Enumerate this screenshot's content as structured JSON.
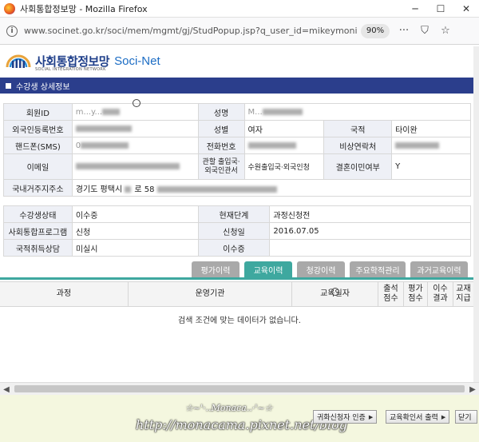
{
  "window": {
    "title": "사회통합정보망 - Mozilla Firefox",
    "minimize": "─",
    "maximize": "☐",
    "close": "✕"
  },
  "toolbar": {
    "url": "www.socinet.go.kr/soci/mem/mgmt/gj/StudPopup.jsp?q_user_id=mikeymonica",
    "zoom": "90%",
    "info_glyph": "i",
    "more_glyph": "···",
    "pocket_glyph": "⛉",
    "bookmark_glyph": "☆"
  },
  "logo": {
    "korean": "사회통합정보망",
    "english": "Soci-Net",
    "subtitle": "SOCIAL INTEGRATION NETWORK"
  },
  "section": {
    "title": "수강생 상세정보"
  },
  "member": {
    "id_label": "회원ID",
    "id_value": "m...y...",
    "name_label": "성명",
    "name_value": "M...",
    "reg_label": "외국인등록번호",
    "reg_value": "",
    "gender_label": "성별",
    "gender_value": "여자",
    "nationality_label": "국적",
    "nationality_value": "타이완",
    "phone_label": "핸드폰(SMS)",
    "phone_value": "0",
    "tel_label": "전화번호",
    "tel_value": "",
    "emergency_label": "비상연락처",
    "emergency_value": "",
    "email_label": "이메일",
    "email_value": "",
    "office_label": "관할 출입국·외국인관서",
    "office_value": "수원출입국·외국인청",
    "marriage_label": "결혼이민여부",
    "marriage_value": "Y",
    "address_label": "국내거주지주소",
    "address_value": "경기도 평택시 ",
    "address_value_2": "로 58"
  },
  "course": {
    "status_label": "수강생상태",
    "status_value": "이수중",
    "stage_label": "현재단계",
    "stage_value": "과정신청전",
    "program_label": "사회통합프로그램",
    "program_value": "신청",
    "apply_label": "신청일",
    "apply_value": "2016.07.05",
    "consult_label": "국적취득상담",
    "consult_value": "미실시",
    "cert_label": "이수증",
    "cert_value": ""
  },
  "tabs": [
    "평가이력",
    "교육이력",
    "청강이력",
    "주요학적관리",
    "과거교육이력"
  ],
  "table": {
    "columns": [
      "과정",
      "운영기관",
      "교육일자",
      "출석\n점수",
      "평가\n점수",
      "이수\n결과",
      "교재\n지급"
    ],
    "empty_message": "검색 조건에 맞는 데이터가 없습니다."
  },
  "scrollbar": {
    "left_arrow": "◀",
    "right_arrow": "▶"
  },
  "watermark": {
    "line1": "☆~'·..Monaca..·'~☆",
    "line2": "http://monacama.pixnet.net/blog"
  },
  "footer_buttons": {
    "cert_check": "귀화신청자 인증",
    "edu_cert_print": "교육확인서 출력",
    "close": "닫기",
    "arrow": "▶"
  }
}
